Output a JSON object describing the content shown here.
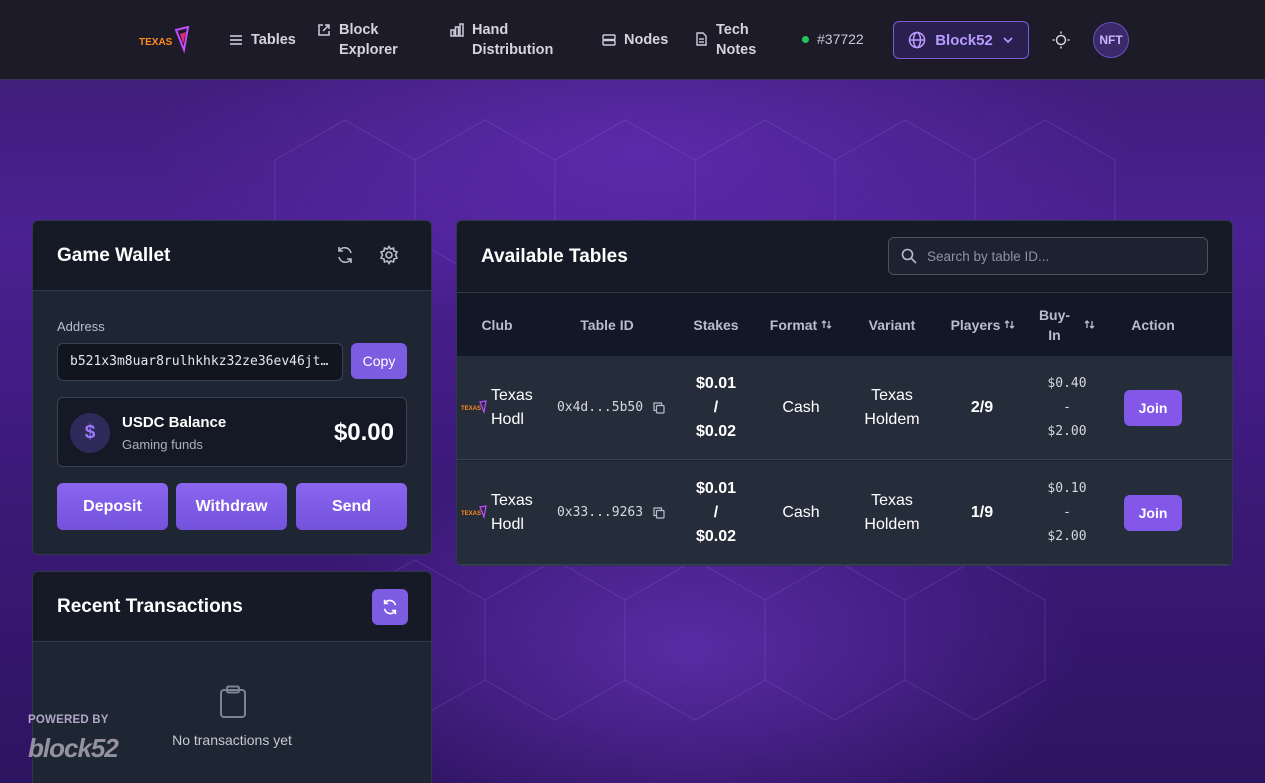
{
  "nav": {
    "items": [
      {
        "label": "Tables",
        "icon": "list-icon"
      },
      {
        "label_line1": "Block",
        "label_line2": "Explorer",
        "icon": "external-link-icon"
      },
      {
        "label_line1": "Hand",
        "label_line2": "Distribution",
        "icon": "bar-chart-icon"
      },
      {
        "label": "Nodes",
        "icon": "server-icon"
      },
      {
        "label_line1": "Tech",
        "label_line2": "Notes",
        "icon": "document-icon"
      }
    ],
    "block_height": "#37722",
    "network": "Block52",
    "nft_label": "NFT"
  },
  "wallet": {
    "title": "Game Wallet",
    "address_label": "Address",
    "address_value": "b521x3m8uar8rulhkhkz32ze36ev46jt…",
    "copy_label": "Copy",
    "balance_title": "USDC Balance",
    "balance_sub": "Gaming funds",
    "balance_symbol": "$",
    "balance_amount": "$0.00",
    "deposit_label": "Deposit",
    "withdraw_label": "Withdraw",
    "send_label": "Send"
  },
  "transactions": {
    "title": "Recent Transactions",
    "empty_text": "No transactions yet"
  },
  "tables": {
    "title": "Available Tables",
    "search_placeholder": "Search by table ID...",
    "headers": {
      "club": "Club",
      "table_id": "Table ID",
      "stakes": "Stakes",
      "format": "Format",
      "variant": "Variant",
      "players": "Players",
      "buyin_line1": "Buy-",
      "buyin_line2": "In",
      "action": "Action"
    },
    "rows": [
      {
        "club_line1": "Texas",
        "club_line2": "Hodl",
        "table_id": "0x4d...5b50",
        "stakes_line1": "$0.01",
        "stakes_line2": "/",
        "stakes_line3": "$0.02",
        "format": "Cash",
        "variant_line1": "Texas",
        "variant_line2": "Holdem",
        "players": "2/9",
        "buyin_line1": "$0.40",
        "buyin_line2": "-",
        "buyin_line3": "$2.00",
        "action": "Join"
      },
      {
        "club_line1": "Texas",
        "club_line2": "Hodl",
        "table_id": "0x33...9263",
        "stakes_line1": "$0.01",
        "stakes_line2": "/",
        "stakes_line3": "$0.02",
        "format": "Cash",
        "variant_line1": "Texas",
        "variant_line2": "Holdem",
        "players": "1/9",
        "buyin_line1": "$0.10",
        "buyin_line2": "-",
        "buyin_line3": "$2.00",
        "action": "Join"
      }
    ]
  },
  "footer": {
    "powered_by": "POWERED BY",
    "brand_logo": "block52"
  },
  "colors": {
    "accent": "#7c5ce0",
    "nav_bg": "#1e1b29",
    "card_bg": "#1f2633",
    "status_dot": "#22c55e"
  }
}
